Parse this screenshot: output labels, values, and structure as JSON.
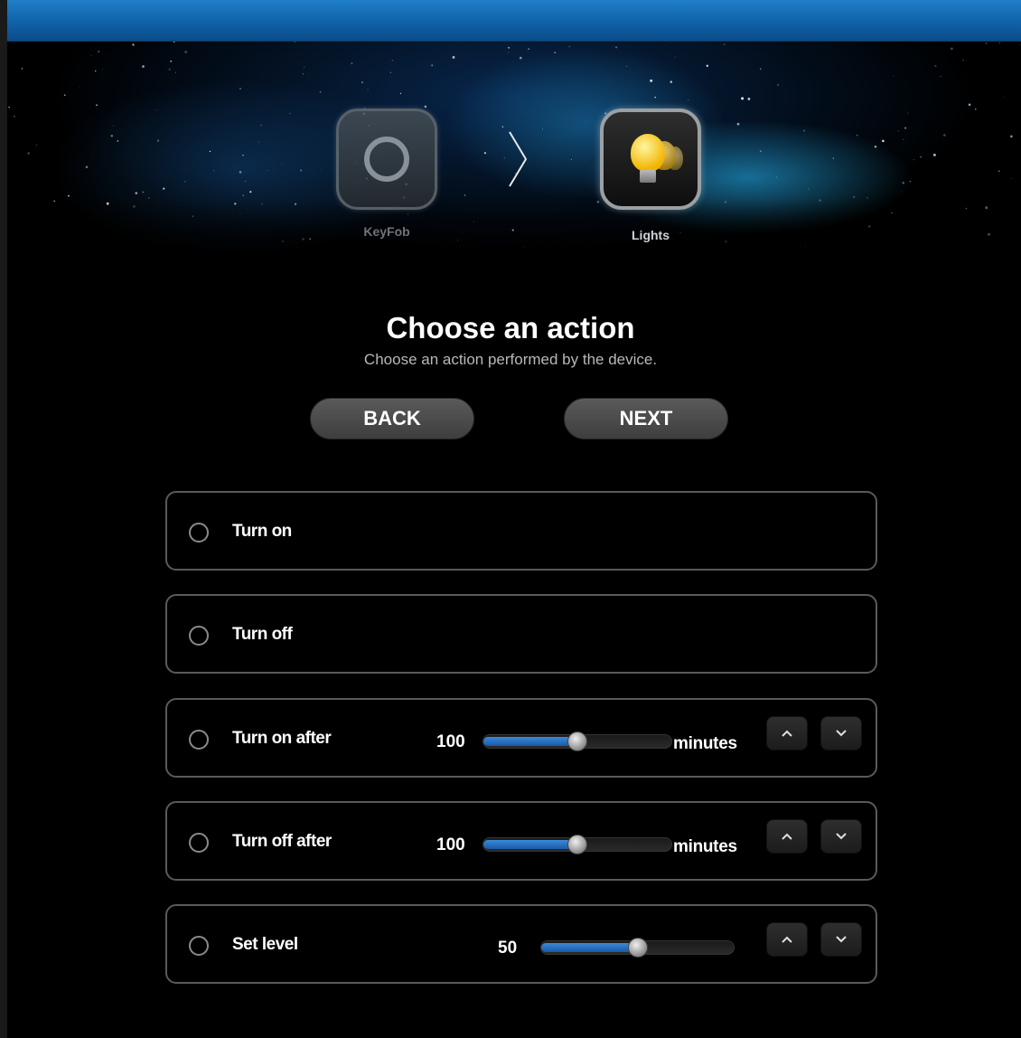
{
  "wizard": {
    "steps": [
      {
        "label": "KeyFob",
        "icon": "keyfob-ring-icon",
        "state": "done"
      },
      {
        "label": "Lights",
        "icon": "light-bulb-icon",
        "state": "current"
      }
    ]
  },
  "header": {
    "title": "Choose an action",
    "subtitle": "Choose an action performed by the device."
  },
  "nav": {
    "back_label": "BACK",
    "next_label": "NEXT"
  },
  "options": [
    {
      "label": "Turn on",
      "selected": false
    },
    {
      "label": "Turn off",
      "selected": false
    },
    {
      "label": "Turn on after",
      "selected": false,
      "value": "100",
      "unit": "minutes",
      "slider_fraction": 0.5
    },
    {
      "label": "Turn off after",
      "selected": false,
      "value": "100",
      "unit": "minutes",
      "slider_fraction": 0.5
    },
    {
      "label": "Set level",
      "selected": false,
      "value": "50",
      "slider_fraction": 0.5
    }
  ],
  "colors": {
    "title_bar": "#1570b8",
    "slider_fill": "#2a7ad0",
    "button_bg": "#4a4a4a",
    "option_border": "#5a5a5a"
  }
}
